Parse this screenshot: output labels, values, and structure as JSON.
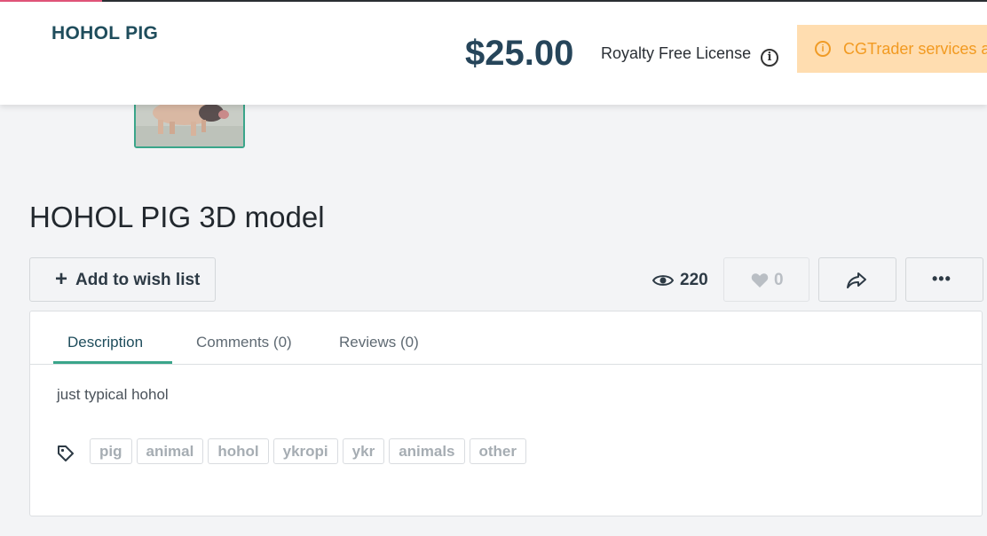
{
  "header": {
    "product_name": "HOHOL PIG",
    "price": "$25.00",
    "license": "Royalty Free License",
    "notice": "CGTrader services a"
  },
  "model": {
    "title": "HOHOL PIG 3D model"
  },
  "actions": {
    "add_to_wish_list": "Add to wish list",
    "views": "220",
    "likes": "0"
  },
  "tabs": [
    {
      "label": "Description",
      "active": true
    },
    {
      "label": "Comments (0)",
      "active": false
    },
    {
      "label": "Reviews (0)",
      "active": false
    }
  ],
  "description": "just typical hohol",
  "tags": [
    "pig",
    "animal",
    "hohol",
    "ykropi",
    "ykr",
    "animals",
    "other"
  ],
  "colors": {
    "accent": "#3aa58a",
    "brand_dark": "#1f4d5c",
    "notice_bg": "#ffddb0",
    "notice_text": "#f29a21"
  },
  "icons": [
    "info-icon",
    "alert-icon",
    "plus-icon",
    "eye-icon",
    "heart-icon",
    "share-icon",
    "more-icon",
    "tag-icon"
  ]
}
